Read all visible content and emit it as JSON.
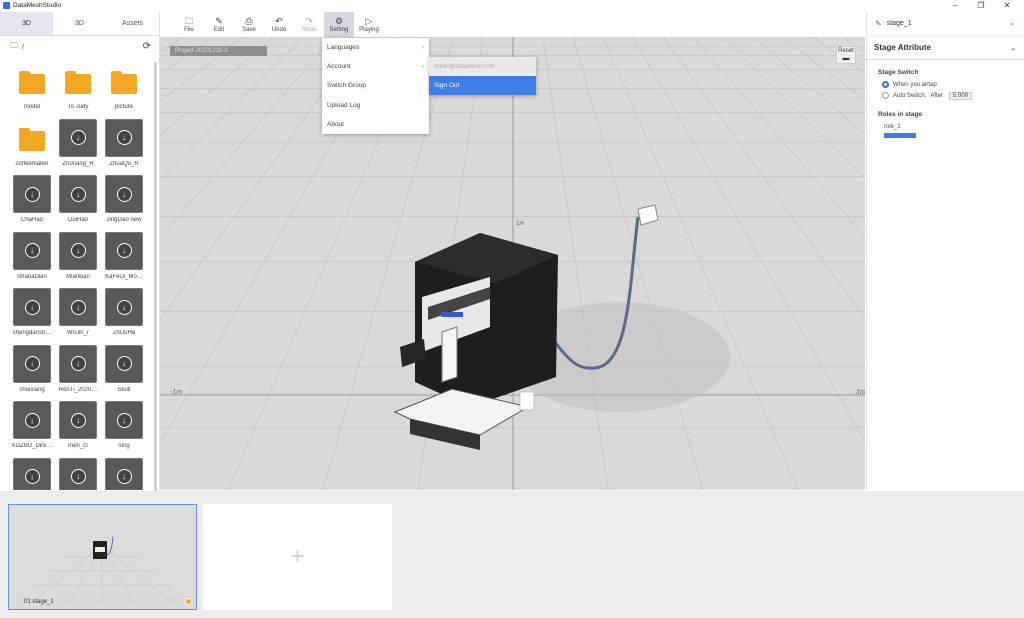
{
  "app": {
    "title": "DataMeshStudio"
  },
  "window_controls": [
    "–",
    "❐",
    "✕"
  ],
  "left_panel": {
    "tabs": [
      {
        "label": "3D"
      },
      {
        "label": "3D"
      },
      {
        "label": "Assets"
      }
    ],
    "path": "/",
    "assets": [
      {
        "name": "model",
        "kind": "folder"
      },
      {
        "name": "To Judy",
        "kind": "folder"
      },
      {
        "name": "picture",
        "kind": "folder"
      },
      {
        "name": "coffeemaker",
        "kind": "folder"
      },
      {
        "name": "ZhiXiang_R",
        "kind": "model"
      },
      {
        "name": "ZhuaQu_R",
        "kind": "model"
      },
      {
        "name": "ChaHao",
        "kind": "model"
      },
      {
        "name": "DuiHao",
        "kind": "model"
      },
      {
        "name": "JingGao new",
        "kind": "model"
      },
      {
        "name": "ShanaDian",
        "kind": "model"
      },
      {
        "name": "MianBan",
        "kind": "model"
      },
      {
        "name": "KaFeiJi_Mo…",
        "kind": "model"
      },
      {
        "name": "shengdansh…",
        "kind": "model"
      },
      {
        "name": "WoJin_r",
        "kind": "model"
      },
      {
        "name": "ZhiJuHe",
        "kind": "model"
      },
      {
        "name": "shuixiang",
        "kind": "model"
      },
      {
        "name": "RenTi_2020…",
        "kind": "model"
      },
      {
        "name": "Skull",
        "kind": "model"
      },
      {
        "name": "XGZBD_Dire…",
        "kind": "model"
      },
      {
        "name": "men_G",
        "kind": "model"
      },
      {
        "name": "lung",
        "kind": "model"
      },
      {
        "name": "",
        "kind": "model"
      },
      {
        "name": "",
        "kind": "model"
      },
      {
        "name": "",
        "kind": "model"
      }
    ]
  },
  "toolbar": {
    "file": "File",
    "edit": "Edit",
    "save": "Save",
    "undo": "Undo",
    "redo": "Redo",
    "setting": "Setting",
    "playing": "Playing"
  },
  "setting_menu": {
    "items": [
      {
        "label": "Languages"
      },
      {
        "label": "Account"
      },
      {
        "label": "Switch Group"
      },
      {
        "label": "Upload Log"
      },
      {
        "label": "About"
      }
    ],
    "account_submenu": {
      "email": "lixtion@datamesh.com",
      "sign_out": "Sign Out"
    }
  },
  "viewport": {
    "project_label": "Project-20201222-2",
    "reset_label": "Reset",
    "axis_labels": [
      "1m",
      "-1m",
      "1m"
    ]
  },
  "right_panel": {
    "stage_name": "stage_1",
    "section_title": "Stage Attribute",
    "stage_switch": {
      "label": "Stage Switch",
      "option_airtap": "When you airtap",
      "option_auto": "Auto Switch,",
      "after_label": "After",
      "after_value": "5.000"
    },
    "roles": {
      "label": "Roles in stage",
      "role_name": "role_1"
    }
  },
  "bottom": {
    "slot_label": "01  stage_1"
  }
}
